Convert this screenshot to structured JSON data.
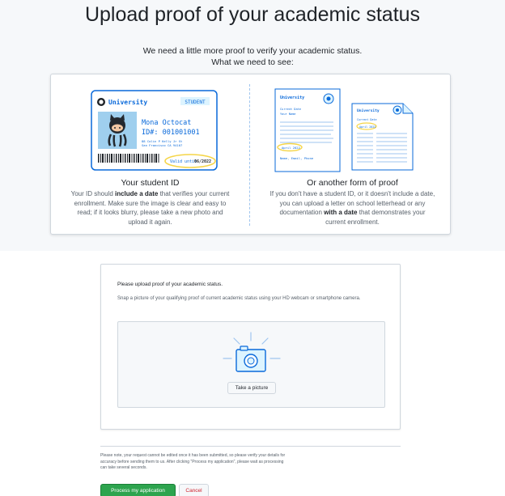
{
  "header": {
    "title": "Upload proof of your academic status",
    "subtitle_line1": "We need a little more proof to verify your academic status.",
    "subtitle_line2": "What we need to see:"
  },
  "student_id": {
    "title": "Your student ID",
    "text_before": "Your ID should ",
    "text_bold": "include a date",
    "text_after": " that verifies your current enrollment. Make sure the image is clear and easy to read; if it looks blurry, please take a new photo and upload it again.",
    "card": {
      "university": "University",
      "badge": "STUDENT",
      "name": "Mona Octocat",
      "id_number": "ID#: 001001001",
      "address_line1": "88 Colin P Kelly Jr St",
      "address_line2": "San Francisco CA 94107",
      "valid_label": "Valid until",
      "valid_date": "06/2022"
    }
  },
  "other_proof": {
    "title": "Or another form of proof",
    "text_before": "If you don't have a student ID, or it doesn't include a date, you can upload a letter on school letterhead or any documentation ",
    "text_bold": "with a date",
    "text_after": " that demonstrates your current enrollment.",
    "letter": {
      "university": "University",
      "current_date": "Current Date",
      "your_name": "Your Name",
      "date_value": "April 2022",
      "signature": "Name, Email, Phone"
    },
    "doc2": {
      "university": "University",
      "current_date": "Current Date",
      "date_value": "April 2022"
    }
  },
  "upload": {
    "heading": "Please upload proof of your academic status.",
    "help": "Snap a picture of your qualifying proof of current academic status using your HD webcam or smartphone camera.",
    "take_picture_label": "Take a picture"
  },
  "note": "Please note, your request cannot be edited once it has been submitted, so please verify your details for accuracy before sending them to us. After clicking \"Process my application\", please wait as processing can take several seconds.",
  "buttons": {
    "process_label": "Process my application",
    "cancel_label": "Cancel"
  },
  "colors": {
    "accent_blue": "#0969da",
    "highlight_yellow": "#f5d547",
    "button_green": "#2da44e",
    "danger_red": "#cf222e"
  }
}
